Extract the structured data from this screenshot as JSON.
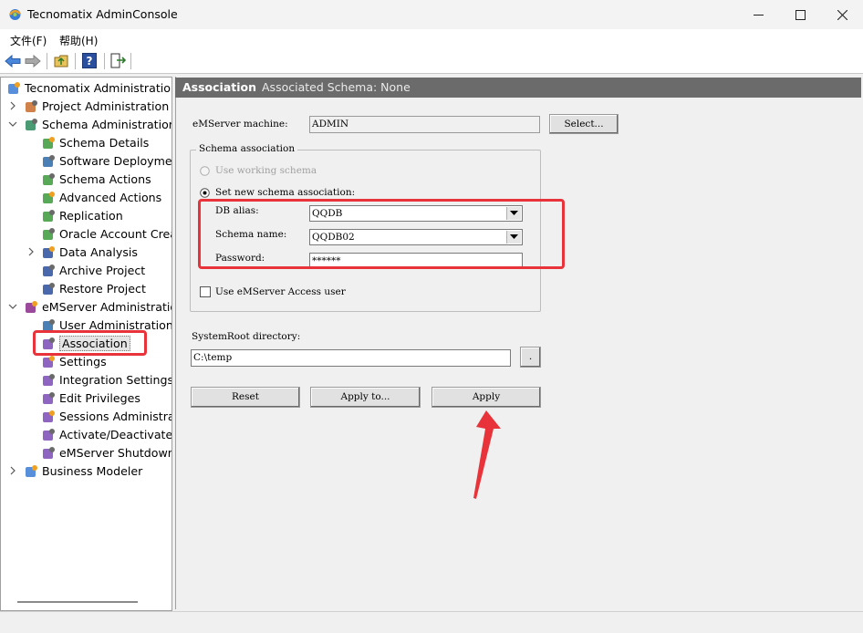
{
  "window": {
    "title": "Tecnomatix AdminConsole"
  },
  "menu": {
    "items": [
      "文件(F)",
      "帮助(H)"
    ]
  },
  "tree": {
    "items": [
      {
        "label": "Tecnomatix Administration",
        "icon": "tecnomatix-globe-icon"
      },
      {
        "label": "Project Administration",
        "icon": "project-icon"
      },
      {
        "label": "Schema Administration",
        "icon": "schema-admin-icon"
      },
      {
        "label": "Schema Details",
        "icon": "schema-details-icon"
      },
      {
        "label": "Software Deploymen",
        "icon": "software-deploy-icon"
      },
      {
        "label": "Schema Actions",
        "icon": "database-icon"
      },
      {
        "label": "Advanced Actions",
        "icon": "database-icon"
      },
      {
        "label": "Replication",
        "icon": "database-icon"
      },
      {
        "label": "Oracle Account Creat",
        "icon": "oracle-icon"
      },
      {
        "label": "Data Analysis",
        "icon": "sql-icon"
      },
      {
        "label": "Archive Project",
        "icon": "archive-icon"
      },
      {
        "label": "Restore Project",
        "icon": "restore-icon"
      },
      {
        "label": "eMServer Administration",
        "icon": "emserver-icon"
      },
      {
        "label": "User Administration",
        "icon": "user-icon"
      },
      {
        "label": "Association",
        "icon": "association-icon"
      },
      {
        "label": "Settings",
        "icon": "settings-icon"
      },
      {
        "label": "Integration Settings",
        "icon": "integration-icon"
      },
      {
        "label": "Edit Privileges",
        "icon": "privileges-icon"
      },
      {
        "label": "Sessions Administrat",
        "icon": "sessions-icon"
      },
      {
        "label": "Activate/Deactivate L",
        "icon": "activate-icon"
      },
      {
        "label": "eMServer Shutdown",
        "icon": "shutdown-icon"
      },
      {
        "label": "Business Modeler",
        "icon": "business-modeler-icon"
      }
    ]
  },
  "panel": {
    "title": "Association",
    "subtitle": "Associated Schema: None",
    "emserver_label": "eMServer machine:",
    "emserver_value": "ADMIN",
    "select_button": "Select...",
    "schema_group": "Schema association",
    "use_working": "Use working schema",
    "set_new": "Set new schema association:",
    "db_alias_label": "DB alias:",
    "db_alias_value": "QQDB",
    "schema_name_label": "Schema name:",
    "schema_name_value": "QQDB02",
    "password_label": "Password:",
    "password_value": "******",
    "use_access_user": "Use eMServer Access user",
    "sysroot_label": "SystemRoot directory:",
    "sysroot_value": "C:\\temp",
    "browse_button": ".",
    "reset_button": "Reset",
    "apply_to_button": "Apply to...",
    "apply_button": "Apply"
  },
  "colors": {
    "annotation": "#e8333a",
    "header": "#6b6b6b"
  }
}
